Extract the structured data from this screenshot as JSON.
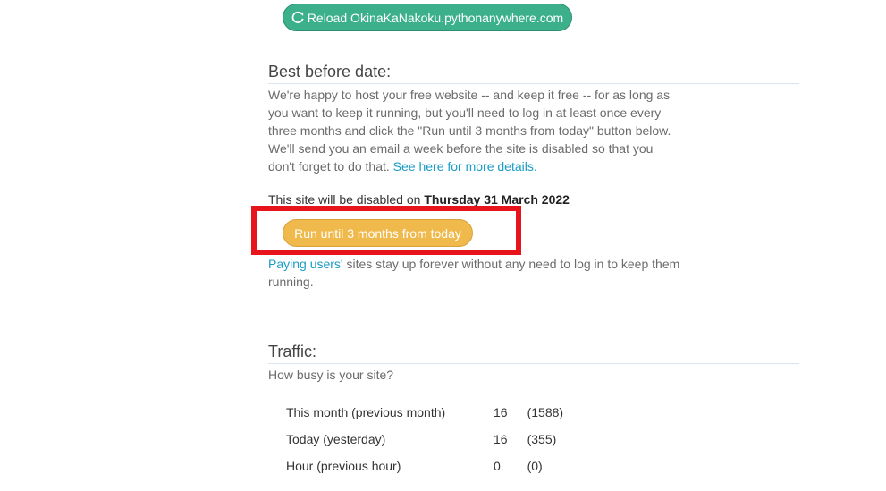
{
  "reload": {
    "icon": "refresh-icon",
    "label": "Reload OkinaKaNakoku.pythonanywhere.com"
  },
  "best_before": {
    "title": "Best before date:",
    "paragraph": "We're happy to host your free website -- and keep it free -- for as long as you want to keep it running, but you'll need to log in at least once every three months and click the \"Run until 3 months from today\" button below. We'll send you an email a week before the site is disabled so that you don't forget to do that.",
    "details_link": "See here for more details.",
    "disable_prefix": "This site will be disabled on",
    "disable_date": "Thursday 31 March 2022",
    "run_button": "Run until 3 months from today",
    "paying_link": "Paying users'",
    "paying_rest": " sites stay up forever without any need to log in to keep them running."
  },
  "traffic": {
    "title": "Traffic:",
    "subtitle": "How busy is your site?",
    "rows": [
      {
        "label": "This month (previous month)",
        "value": "16",
        "previous": "(1588)"
      },
      {
        "label": "Today (yesterday)",
        "value": "16",
        "previous": "(355)"
      },
      {
        "label": "Hour (previous hour)",
        "value": "0",
        "previous": "(0)"
      }
    ]
  },
  "colors": {
    "reload_button": "#3cb08a",
    "run_button": "#f0b94c",
    "highlight": "#e8141b",
    "link": "#1a9bc6"
  }
}
